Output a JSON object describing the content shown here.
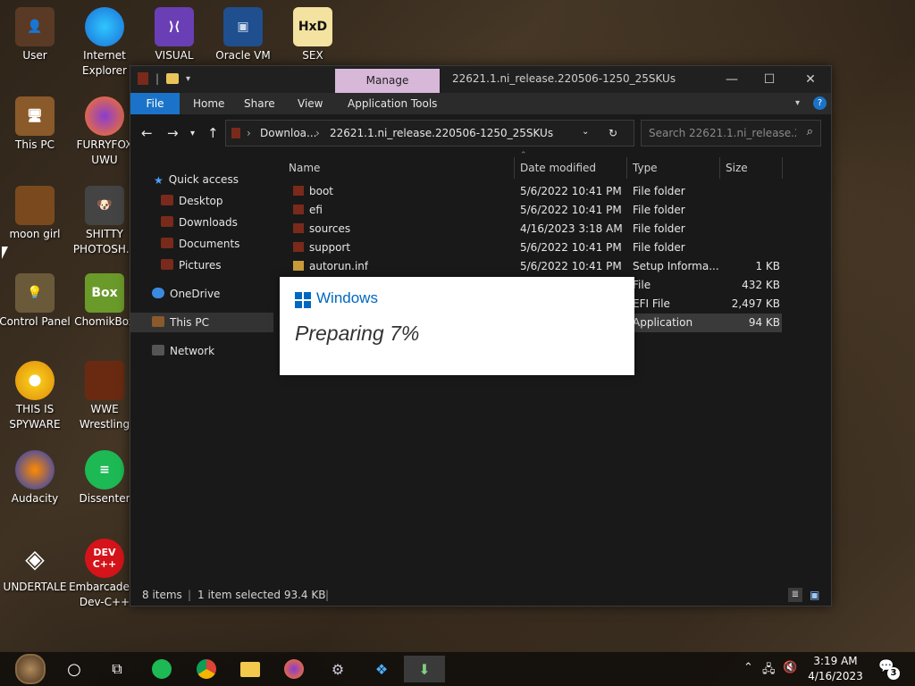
{
  "desktop": {
    "icons": [
      {
        "label": "User"
      },
      {
        "label": "Internet Explorer"
      },
      {
        "label": "VISUAL"
      },
      {
        "label": "Oracle VM"
      },
      {
        "label": "SEX"
      },
      {
        "label": "This PC"
      },
      {
        "label": "FURRYFOX UWU"
      },
      {
        "label": "moon girl"
      },
      {
        "label": "SHITTY PHOTOSH..."
      },
      {
        "label": "Control Panel"
      },
      {
        "label": "ChomikBox"
      },
      {
        "label": "THIS IS SPYWARE"
      },
      {
        "label": "WWE Wrestling"
      },
      {
        "label": "Audacity"
      },
      {
        "label": "Dissenter"
      },
      {
        "label": "UNDERTALE"
      },
      {
        "label": "Embarcadero Dev-C++"
      }
    ]
  },
  "explorer": {
    "context_tab": "Manage",
    "title": "22621.1.ni_release.220506-1250_25SKUs",
    "ribbon_tabs": [
      "File",
      "Home",
      "Share",
      "View",
      "Application Tools"
    ],
    "address": {
      "parent": "Downloa...",
      "current": "22621.1.ni_release.220506-1250_25SKUs"
    },
    "search_placeholder": "Search 22621.1.ni_release.2...",
    "nav": {
      "quick_access": "Quick access",
      "items": [
        "Desktop",
        "Downloads",
        "Documents",
        "Pictures"
      ],
      "onedrive": "OneDrive",
      "this_pc": "This PC",
      "network": "Network"
    },
    "columns": [
      "Name",
      "Date modified",
      "Type",
      "Size"
    ],
    "files": [
      {
        "name": "boot",
        "date": "5/6/2022 10:41 PM",
        "type": "File folder",
        "size": ""
      },
      {
        "name": "efi",
        "date": "5/6/2022 10:41 PM",
        "type": "File folder",
        "size": ""
      },
      {
        "name": "sources",
        "date": "4/16/2023 3:18 AM",
        "type": "File folder",
        "size": ""
      },
      {
        "name": "support",
        "date": "5/6/2022 10:41 PM",
        "type": "File folder",
        "size": ""
      },
      {
        "name": "autorun.inf",
        "date": "5/6/2022 10:41 PM",
        "type": "Setup Informa...",
        "size": "1 KB"
      },
      {
        "name": "",
        "date": "",
        "type": "File",
        "size": "432 KB"
      },
      {
        "name": "",
        "date": "",
        "type": "EFI File",
        "size": "2,497 KB"
      },
      {
        "name": "",
        "date": "",
        "type": "Application",
        "size": "94 KB"
      }
    ],
    "status": {
      "items": "8 items",
      "selected": "1 item selected  93.4 KB"
    }
  },
  "setup_dialog": {
    "brand": "Windows",
    "progress_text": "Preparing 7%",
    "progress": 7
  },
  "taskbar": {
    "time": "3:19 AM",
    "date": "4/16/2023",
    "notification_count": "3"
  }
}
